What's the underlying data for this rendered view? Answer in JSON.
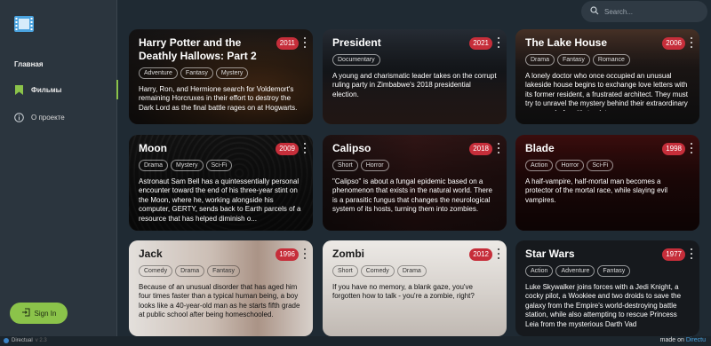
{
  "sidebar": {
    "section_title": "Главная",
    "items": [
      {
        "label": "Фильмы"
      },
      {
        "label": "О проекте"
      }
    ],
    "signin_label": "Sign In"
  },
  "search": {
    "placeholder": "Search..."
  },
  "footer": {
    "brand_left": "Directual",
    "version": "v 2.3",
    "made_on": "made on",
    "made_on_brand": "Directu"
  },
  "colors": {
    "accent": "#8bc34a",
    "year_badge": "#c62e3a",
    "background": "#1f2a33"
  },
  "movies": [
    {
      "title": "Harry Potter and the Deathly Hallows: Part 2",
      "year": "2011",
      "tags": [
        "Adventure",
        "Fantasy",
        "Mystery"
      ],
      "description": "Harry, Ron, and Hermione search for Voldemort's remaining Horcruxes in their effort to destroy the Dark Lord as the final battle rages on at Hogwarts."
    },
    {
      "title": "President",
      "year": "2021",
      "tags": [
        "Documentary"
      ],
      "description": "A young and charismatic leader takes on the corrupt ruling party in Zimbabwe's 2018 presidential election."
    },
    {
      "title": "The Lake House",
      "year": "2006",
      "tags": [
        "Drama",
        "Fantasy",
        "Romance"
      ],
      "description": "A lonely doctor who once occupied an unusual lakeside house begins to exchange love letters with its former resident, a frustrated architect. They must try to unravel the mystery behind their extraordinary romance before it's too lat"
    },
    {
      "title": "Moon",
      "year": "2009",
      "tags": [
        "Drama",
        "Mystery",
        "Sci-Fi"
      ],
      "description": "Astronaut Sam Bell has a quintessentially personal encounter toward the end of his three-year stint on the Moon, where he, working alongside his computer, GERTY, sends back to Earth parcels of a resource that has helped diminish o..."
    },
    {
      "title": "Calipso",
      "year": "2018",
      "tags": [
        "Short",
        "Horror"
      ],
      "description": "\"Calipso\" is about a fungal epidemic based on a phenomenon that exists in the natural world. There is a parasitic fungus that changes the neurological system of its hosts, turning them into zombies."
    },
    {
      "title": "Blade",
      "year": "1998",
      "tags": [
        "Action",
        "Horror",
        "Sci-Fi"
      ],
      "description": "A half-vampire, half-mortal man becomes a protector of the mortal race, while slaying evil vampires."
    },
    {
      "title": "Jack",
      "year": "1996",
      "tags": [
        "Comedy",
        "Drama",
        "Fantasy"
      ],
      "description": "Because of an unusual disorder that has aged him four times faster than a typical human being, a boy looks like a 40-year-old man as he starts fifth grade at public school after being homeschooled."
    },
    {
      "title": "Zombi",
      "year": "2012",
      "tags": [
        "Short",
        "Comedy",
        "Drama"
      ],
      "description": "If you have no memory, a blank gaze, you've forgotten how to talk - you're a zombie, right?"
    },
    {
      "title": "Star Wars",
      "year": "1977",
      "tags": [
        "Action",
        "Adventure",
        "Fantasy"
      ],
      "description": "Luke Skywalker joins forces with a Jedi Knight, a cocky pilot, a Wookiee and two droids to save the galaxy from the Empire's world-destroying battle station, while also attempting to rescue Princess Leia from the mysterious Darth Vad"
    }
  ]
}
